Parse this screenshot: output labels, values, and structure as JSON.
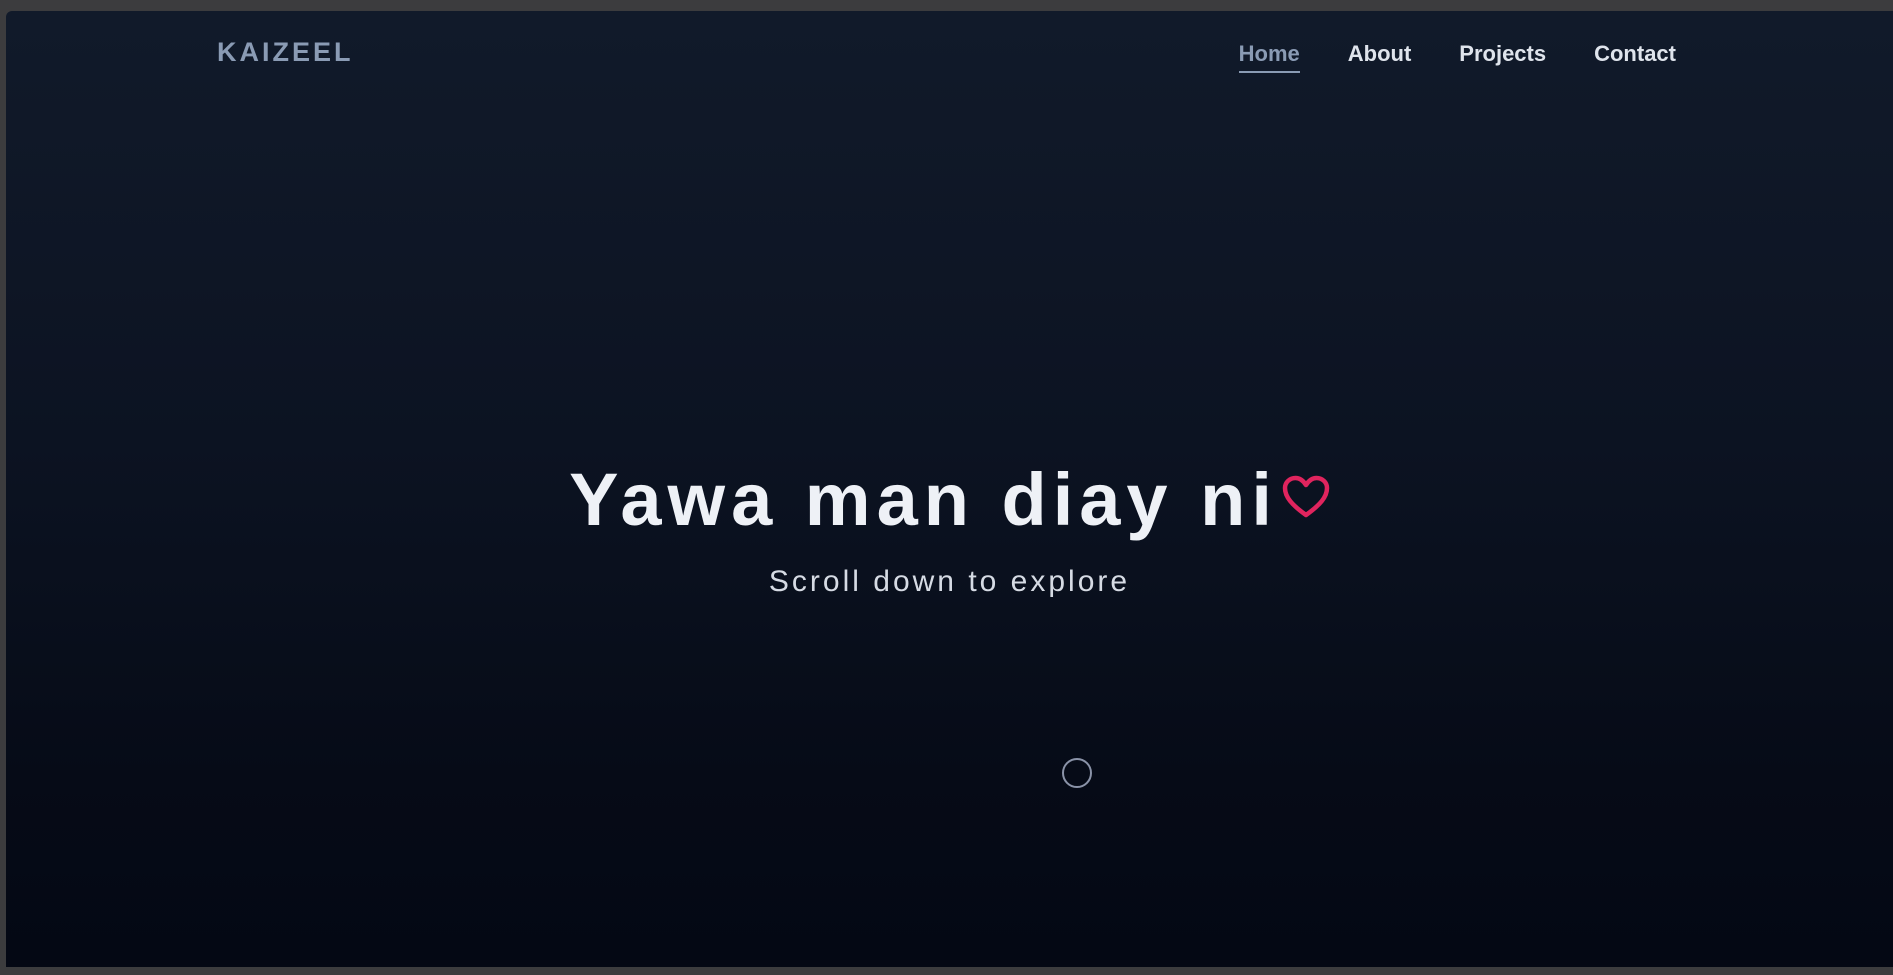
{
  "nav": {
    "brand": "KAIZEEL",
    "links": [
      {
        "label": "Home",
        "active": true
      },
      {
        "label": "About",
        "active": false
      },
      {
        "label": "Projects",
        "active": false
      },
      {
        "label": "Contact",
        "active": false
      }
    ]
  },
  "hero": {
    "title": "Yawa man diay ni",
    "title_icon": "heart-outline-icon",
    "subtitle": "Scroll down to explore"
  },
  "scroll_indicator": {
    "icon": "circle-icon"
  },
  "colors": {
    "background_top": "#111a2a",
    "background_bottom": "#040814",
    "brand": "#8a9bb4",
    "nav_text": "#dfe4ec",
    "heart": "#e0245e",
    "title": "#eef1f6"
  }
}
